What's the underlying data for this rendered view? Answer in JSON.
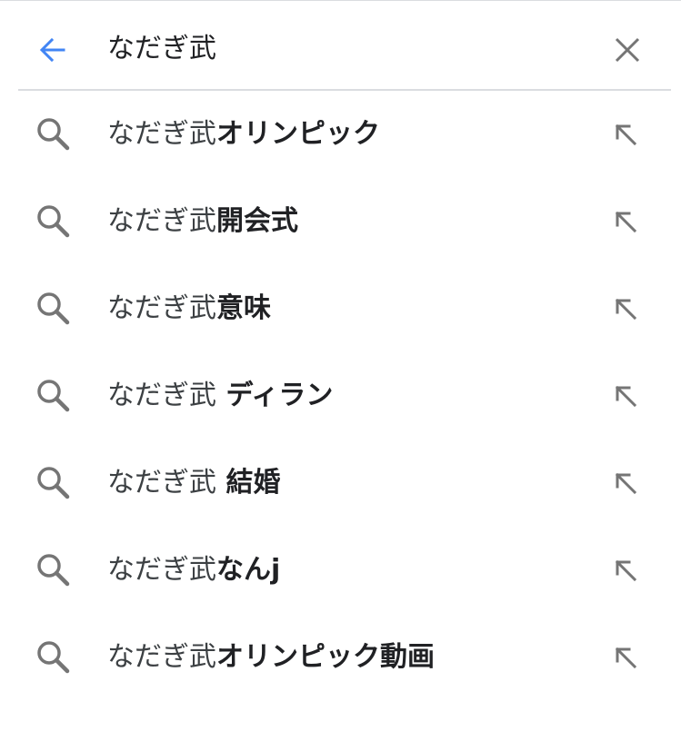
{
  "colors": {
    "accent": "#4285f4",
    "icon_gray": "#757575",
    "divider": "#dadce0",
    "text": "#202124"
  },
  "search": {
    "query": "なだぎ武",
    "back_icon": "arrow-left-icon",
    "clear_icon": "close-icon"
  },
  "suggestions": [
    {
      "base": "なだぎ武",
      "completion": "オリンピック",
      "icon": "search-icon",
      "action_icon": "arrow-up-left-icon"
    },
    {
      "base": "なだぎ武",
      "completion": "開会式",
      "icon": "search-icon",
      "action_icon": "arrow-up-left-icon"
    },
    {
      "base": "なだぎ武",
      "completion": "意味",
      "icon": "search-icon",
      "action_icon": "arrow-up-left-icon"
    },
    {
      "base": "なだぎ武",
      "completion": " ディラン",
      "icon": "search-icon",
      "action_icon": "arrow-up-left-icon"
    },
    {
      "base": "なだぎ武",
      "completion": " 結婚",
      "icon": "search-icon",
      "action_icon": "arrow-up-left-icon"
    },
    {
      "base": "なだぎ武",
      "completion": "なんj",
      "icon": "search-icon",
      "action_icon": "arrow-up-left-icon"
    },
    {
      "base": "なだぎ武",
      "completion": "オリンピック動画",
      "icon": "search-icon",
      "action_icon": "arrow-up-left-icon"
    }
  ]
}
